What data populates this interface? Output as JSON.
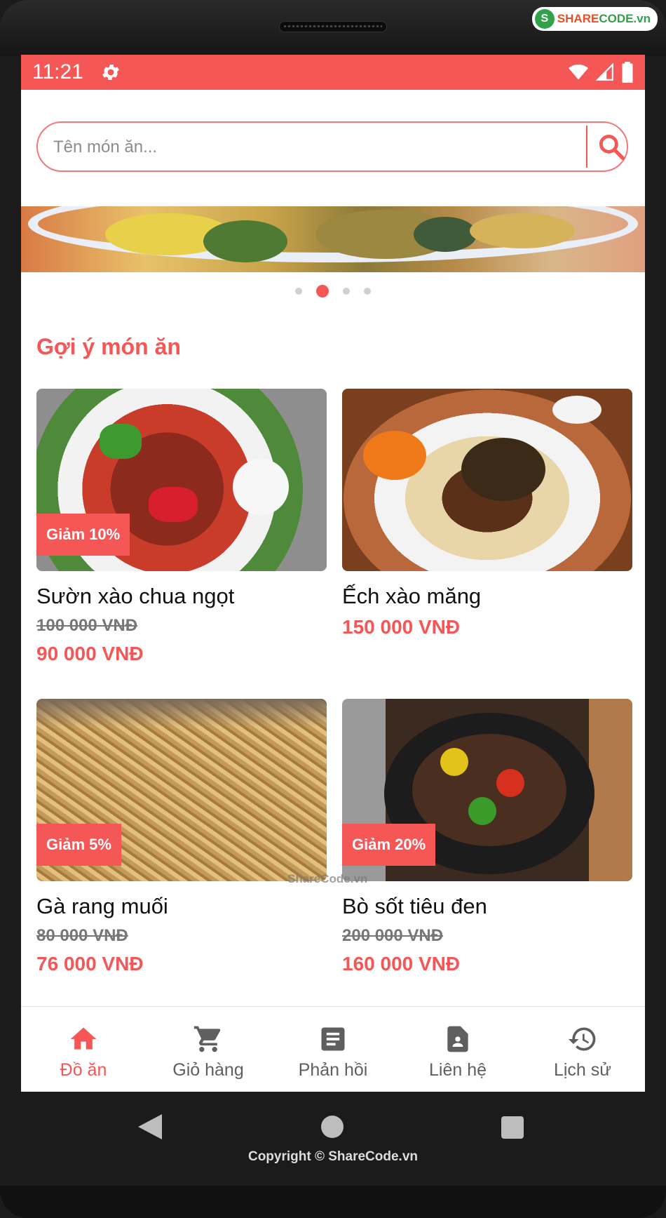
{
  "watermark": {
    "brand_mark": "S",
    "brand_name": "SHARE",
    "brand_suffix": "CODE.vn",
    "center_text": "ShareCode.vn"
  },
  "status_bar": {
    "time": "11:21",
    "icons": [
      "settings-icon",
      "wifi-icon",
      "signal-icon",
      "battery-icon"
    ]
  },
  "search": {
    "placeholder": "Tên món ăn...",
    "value": "",
    "button_icon": "search-icon"
  },
  "carousel": {
    "slides": 4,
    "active_index": 1
  },
  "section": {
    "title": "Gợi ý món ăn"
  },
  "products": [
    {
      "name": "Sườn xào chua ngọt",
      "discount": "Giảm 10%",
      "old_price": "100 000 VNĐ",
      "price": "90 000 VNĐ"
    },
    {
      "name": "Ếch xào măng",
      "discount": "",
      "old_price": "",
      "price": "150 000 VNĐ"
    },
    {
      "name": "Gà rang muối",
      "discount": "Giảm 5%",
      "old_price": "80 000 VNĐ",
      "price": "76 000 VNĐ"
    },
    {
      "name": "Bò sốt tiêu đen",
      "discount": "Giảm 20%",
      "old_price": "200 000 VNĐ",
      "price": "160 000 VNĐ"
    }
  ],
  "bottom_nav": [
    {
      "label": "Đồ ăn",
      "icon": "home-icon",
      "active": true
    },
    {
      "label": "Giỏ hàng",
      "icon": "cart-icon",
      "active": false
    },
    {
      "label": "Phản hồi",
      "icon": "feedback-icon",
      "active": false
    },
    {
      "label": "Liên hệ",
      "icon": "contact-icon",
      "active": false
    },
    {
      "label": "Lịch sử",
      "icon": "history-icon",
      "active": false
    }
  ],
  "footer": {
    "copyright": "Copyright © ShareCode.vn"
  },
  "colors": {
    "accent": "#f55656",
    "text": "#111111",
    "muted": "#777777"
  }
}
